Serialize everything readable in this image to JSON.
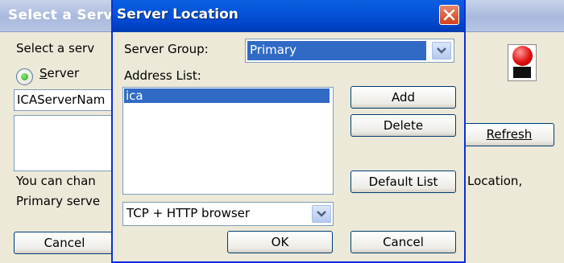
{
  "background": {
    "title": "Select a Server",
    "prompt": "Select a serv",
    "radio_label": "Server",
    "server_input_value": "ICAServerNam",
    "info_line_1_left": "You can chan",
    "info_line_1_right": "Location,",
    "info_line_2_left": "Primary serve",
    "cancel_label": "Cancel",
    "refresh_label": "Refresh"
  },
  "dialog": {
    "title": "Server Location",
    "server_group_label": "Server Group:",
    "server_group_value": "Primary",
    "address_list_label": "Address List:",
    "address_list": [
      "ica"
    ],
    "protocol_value": "TCP + HTTP browser",
    "buttons": {
      "add": "Add",
      "delete": "Delete",
      "default_list": "Default List",
      "ok": "OK",
      "cancel": "Cancel"
    }
  },
  "colors": {
    "title_bar": "#0054e3",
    "selection": "#316ac5",
    "close_button": "#d2401c"
  }
}
